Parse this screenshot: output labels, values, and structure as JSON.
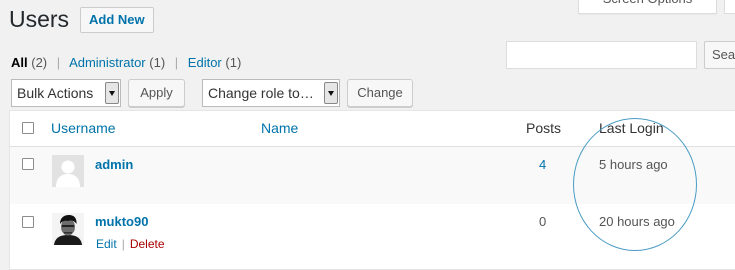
{
  "page": {
    "title": "Users",
    "add_new_label": "Add New",
    "screen_options_label": "Screen Options",
    "search_button_label": "Sea",
    "search_value": ""
  },
  "views": [
    {
      "label": "All",
      "count": "(2)"
    },
    {
      "label": "Administrator",
      "count": "(1)"
    },
    {
      "label": "Editor",
      "count": "(1)"
    }
  ],
  "bulk_actions": {
    "selected": "Bulk Actions",
    "apply_label": "Apply"
  },
  "change_role": {
    "selected": "Change role to…",
    "change_label": "Change"
  },
  "table": {
    "columns": {
      "username": "Username",
      "name": "Name",
      "posts": "Posts",
      "last_login": "Last Login"
    },
    "rows": [
      {
        "username": "admin",
        "name": "",
        "posts": "4",
        "last_login": "5 hours ago",
        "actions": []
      },
      {
        "username": "mukto90",
        "name": "",
        "posts": "0",
        "last_login": "20 hours ago",
        "actions": [
          "Edit",
          "Delete"
        ]
      }
    ]
  },
  "colors": {
    "link": "#0073aa",
    "delete": "#aa0000",
    "annotation_circle": "#4a9cc4"
  },
  "icons": {
    "default_avatar": "person-silhouette-icon",
    "user_photo": "user-photo-icon",
    "select_arrow": "chevron-down-icon"
  }
}
